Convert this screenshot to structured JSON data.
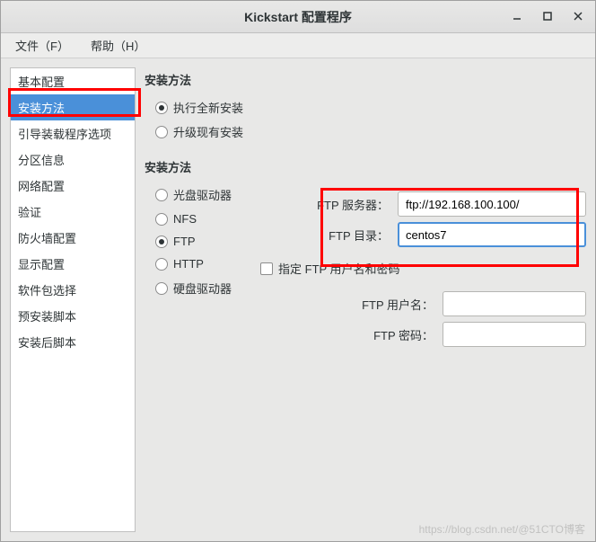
{
  "window": {
    "title": "Kickstart 配置程序"
  },
  "menu": {
    "file": "文件（F）",
    "help": "帮助（H）"
  },
  "sidebar": {
    "items": [
      {
        "label": "基本配置"
      },
      {
        "label": "安装方法"
      },
      {
        "label": "引导装载程序选项"
      },
      {
        "label": "分区信息"
      },
      {
        "label": "网络配置"
      },
      {
        "label": "验证"
      },
      {
        "label": "防火墙配置"
      },
      {
        "label": "显示配置"
      },
      {
        "label": "软件包选择"
      },
      {
        "label": "预安装脚本"
      },
      {
        "label": "安装后脚本"
      }
    ],
    "selected_index": 1
  },
  "panel": {
    "section1_title": "安装方法",
    "install_type": {
      "fresh": "执行全新安装",
      "upgrade": "升级现有安装",
      "selected": "fresh"
    },
    "section2_title": "安装方法",
    "method": {
      "cdrom": "光盘驱动器",
      "nfs": "NFS",
      "ftp": "FTP",
      "http": "HTTP",
      "hdd": "硬盘驱动器",
      "selected": "ftp"
    },
    "ftp": {
      "server_label": "FTP 服务器：",
      "server_value": "ftp://192.168.100.100/",
      "dir_label": "FTP 目录：",
      "dir_value": "centos7",
      "auth_checkbox": "指定 FTP 用户名和密码",
      "user_label": "FTP 用户名：",
      "user_value": "",
      "pass_label": "FTP 密码：",
      "pass_value": ""
    }
  },
  "watermark": "https://blog.csdn.net/@51CTO博客"
}
